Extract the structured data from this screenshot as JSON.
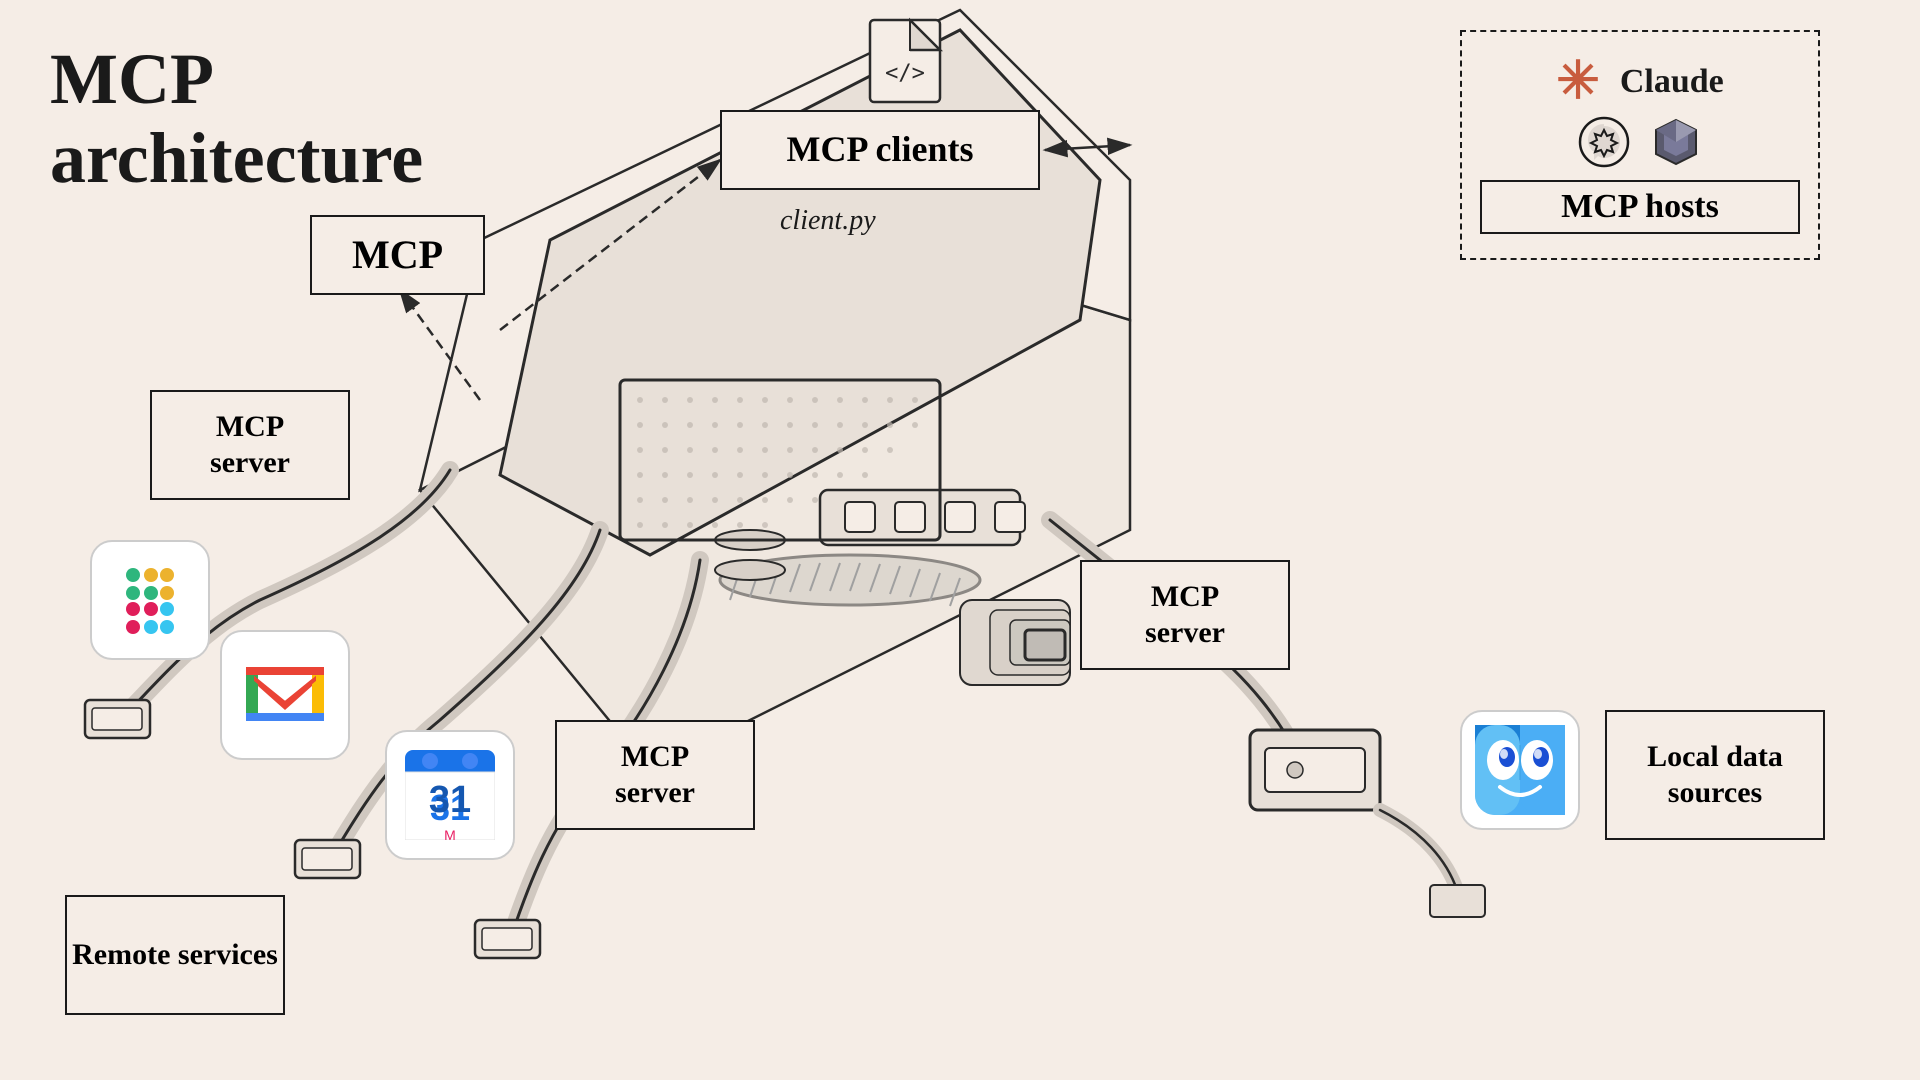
{
  "title": {
    "line1": "MCP",
    "line2": "architecture"
  },
  "boxes": {
    "mcp_clients": "MCP clients",
    "client_py": "client.py",
    "mcp_hosts": "MCP hosts",
    "mcp": "MCP",
    "mcp_server_1": "MCP\nserver",
    "mcp_server_2": "MCP\nserver",
    "mcp_server_3": "MCP\nserver",
    "remote_services": "Remote\nservices",
    "local_data": "Local data\nsources"
  },
  "hosts": {
    "claude_label": "Claude",
    "openai_alt": "OpenAI logo",
    "obsidian_alt": "Obsidian logo"
  },
  "colors": {
    "bg": "#f5ede6",
    "border": "#1a1a1a",
    "claude_red": "#c85c3e",
    "slack_blue": "#4A154B",
    "slack_red": "#E01E5A",
    "slack_yellow": "#ECB22E",
    "slack_green": "#2EB67D"
  }
}
